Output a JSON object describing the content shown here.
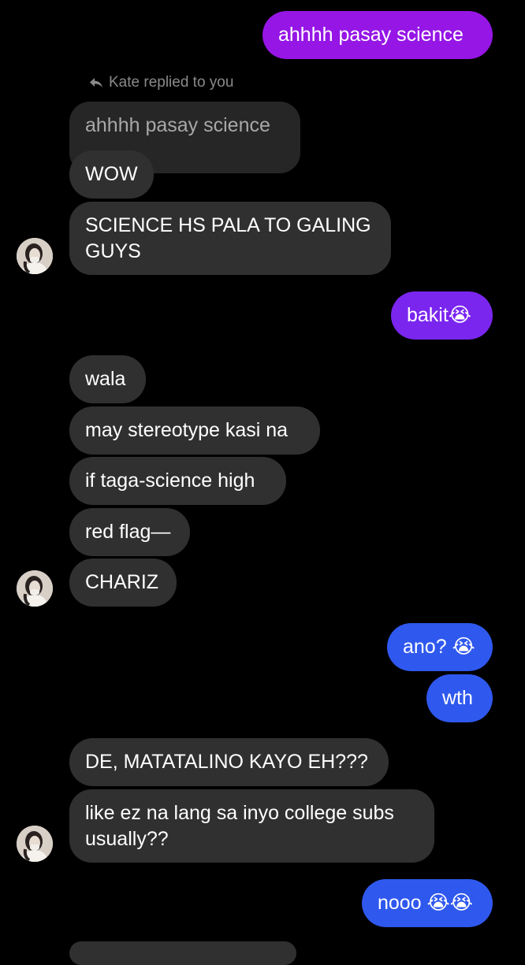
{
  "colors": {
    "background": "#000000",
    "incoming_bubble": "#303030",
    "quoted_bubble": "#262626",
    "quoted_text": "#a8a8a8",
    "outgoing_purple": "#9616e6",
    "outgoing_violet": "#7a26ef",
    "outgoing_blue": "#2f58ee"
  },
  "icons": {
    "reply": "reply-arrow-icon",
    "avatar": "contact-avatar"
  },
  "reply_context": {
    "label": "Kate replied to you",
    "quoted_text": "ahhhh pasay science"
  },
  "messages": [
    {
      "id": "m1",
      "side": "out",
      "text": "ahhhh pasay science"
    },
    {
      "id": "m2",
      "side": "in",
      "text": "WOW"
    },
    {
      "id": "m3",
      "side": "in",
      "text": "SCIENCE HS PALA TO GALING\nGUYS"
    },
    {
      "id": "m4",
      "side": "out",
      "text": "bakit😭"
    },
    {
      "id": "m5",
      "side": "in",
      "text": "wala"
    },
    {
      "id": "m6",
      "side": "in",
      "text": "may stereotype kasi na"
    },
    {
      "id": "m7",
      "side": "in",
      "text": "if taga-science high"
    },
    {
      "id": "m8",
      "side": "in",
      "text": "red flag—"
    },
    {
      "id": "m9",
      "side": "in",
      "text": "CHARIZ"
    },
    {
      "id": "m10",
      "side": "out",
      "text": "ano? 😭"
    },
    {
      "id": "m11",
      "side": "out",
      "text": "wth"
    },
    {
      "id": "m12",
      "side": "in",
      "text": "DE, MATATALINO KAYO EH???"
    },
    {
      "id": "m13",
      "side": "in",
      "text": "like ez na lang sa inyo college subs\nusually??"
    },
    {
      "id": "m14",
      "side": "out",
      "text": "nooo 😭😭"
    }
  ]
}
